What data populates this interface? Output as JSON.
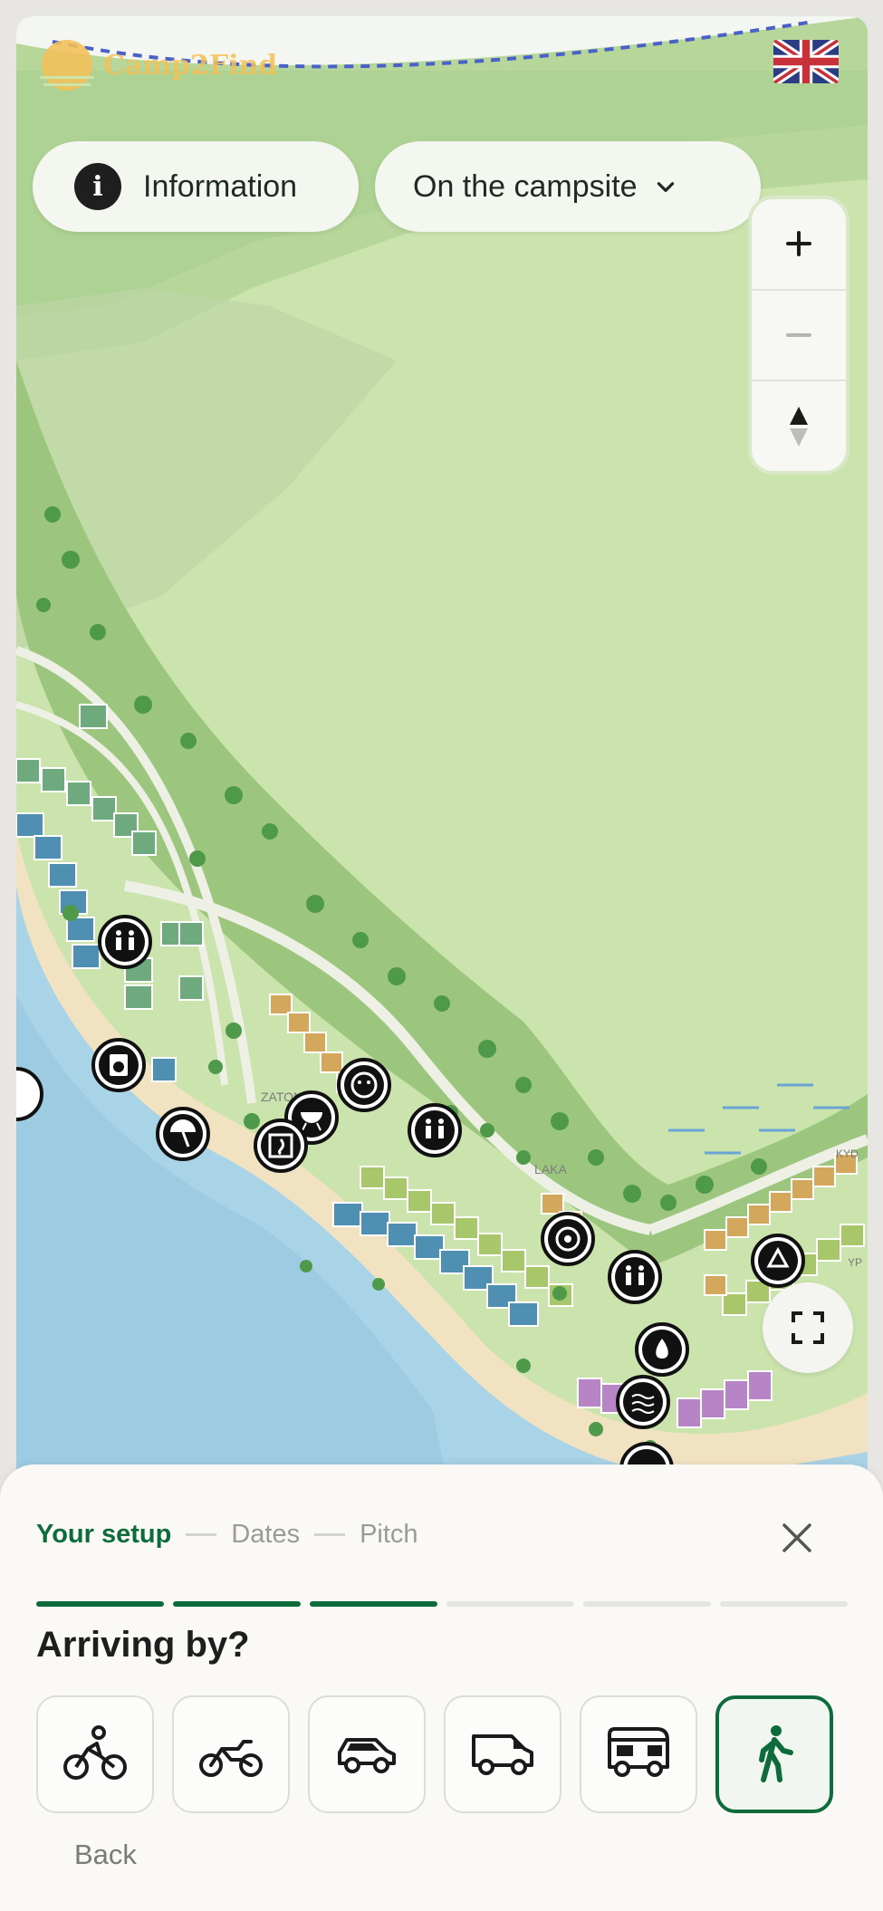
{
  "header": {
    "logo_text": "Camp2Find",
    "language_flag": "uk-flag-icon"
  },
  "filters": {
    "info_label": "Information",
    "category_label": "On the campsite"
  },
  "map": {
    "labels": [
      "ZATON",
      "LAKA",
      "KYD",
      "YP"
    ],
    "water_color": "#a9d3e6",
    "land_color": "#cbe4ad"
  },
  "wizard": {
    "steps": [
      "Your setup",
      "Dates",
      "Pitch"
    ],
    "active_step": "Your setup",
    "progress_total": 6,
    "progress_completed": 3,
    "question": "Arriving by?",
    "options": [
      "bicycle-icon",
      "motorbike-icon",
      "car-icon",
      "van-icon",
      "camper-icon",
      "walking-icon"
    ],
    "selected_option": "walking-icon",
    "back_label": "Back"
  },
  "colors": {
    "accent": "#0e6b3b"
  }
}
